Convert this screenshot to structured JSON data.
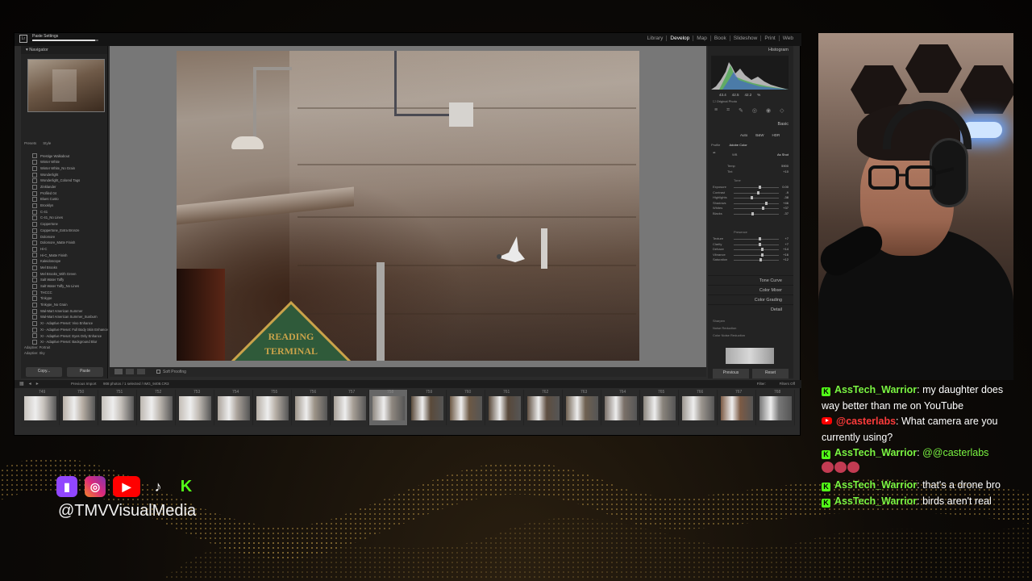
{
  "lightroom": {
    "identity_text": "Paste Settings",
    "progress": 0.95,
    "modules": [
      {
        "label": "Library",
        "active": false
      },
      {
        "label": "Develop",
        "active": true
      },
      {
        "label": "Map",
        "active": false
      },
      {
        "label": "Book",
        "active": false
      },
      {
        "label": "Slideshow",
        "active": false
      },
      {
        "label": "Print",
        "active": false
      },
      {
        "label": "Web",
        "active": false
      }
    ],
    "left_panel": {
      "navigator_label": "Navigator",
      "presets_tabs": [
        "Presets",
        "Style"
      ],
      "items": [
        "Prestige Walkabout",
        "Winter White",
        "Winter White_No Grain",
        "Wonderlight",
        "Wonderlight_Colored Tags",
        "Zinklander",
        "Profiled 04",
        "Blues Custo",
        "Brooklyn",
        "C-41",
        "C-41_No Lines",
        "Coppertone",
        "Coppertone_Extra Bronze",
        "Dolomore",
        "Dolomore_Matte Finish",
        "Hi-C",
        "Hi-C_Matte Finish",
        "Kaleidoscope",
        "Mel Brooks",
        "Mel Brooks_With Green",
        "Salt Water Taffy",
        "Salt Water Taffy_No Lines",
        "THCCC",
        "Tinkype",
        "Tinkype_No Grain",
        "Wal-Mart American Summer",
        "Wal-Mart American Summer_Sunburn",
        "XI - Adaptive Preset: Vivo Enhance",
        "XI - Adaptive Preset: Full Body Skin Enhance",
        "XI - Adaptive Preset: Eyes Only Enhance",
        "XI - Adaptive Preset: Background Blur"
      ],
      "groups": [
        "Adaptive: Portrait",
        "Adaptive: Sky"
      ],
      "copy_button": "Copy...",
      "paste_button": "Paste"
    },
    "center": {
      "toolbar_label": "Soft Proofing"
    },
    "right_panel": {
      "histogram_label": "Histogram",
      "histogram_values": [
        "43.4",
        "42.5",
        "42.2",
        "%"
      ],
      "original_photo": "Original Photo",
      "basic_label": "Basic",
      "treatment_options": [
        "Auto",
        "B&W",
        "HDR"
      ],
      "profile_label": "Profile",
      "profile_value": "Adobe Color",
      "wb_label": "WB",
      "wb_value": "As Shot",
      "temp_label": "Temp",
      "temp_value": "5900",
      "tint_label": "Tint",
      "tint_value": "+10",
      "tone_label": "Tone",
      "sliders": [
        {
          "label": "Exposure",
          "value": "0.00",
          "pos": 0.55
        },
        {
          "label": "Contrast",
          "value": "-9",
          "pos": 0.52
        },
        {
          "label": "Highlights",
          "value": "-38",
          "pos": 0.38
        },
        {
          "label": "Shadows",
          "value": "+46",
          "pos": 0.7
        },
        {
          "label": "Whites",
          "value": "+37",
          "pos": 0.62
        },
        {
          "label": "Blacks",
          "value": "-37",
          "pos": 0.4
        }
      ],
      "presence_label": "Presence",
      "presence_sliders": [
        {
          "label": "Texture",
          "value": "+7",
          "pos": 0.56
        },
        {
          "label": "Clarity",
          "value": "+7",
          "pos": 0.56
        },
        {
          "label": "Dehaze",
          "value": "+14",
          "pos": 0.6
        },
        {
          "label": "Vibrance",
          "value": "+16",
          "pos": 0.6
        },
        {
          "label": "Saturation",
          "value": "+12",
          "pos": 0.58
        }
      ],
      "sections": [
        "Tone Curve",
        "Color Mixer",
        "Color Grading",
        "Detail"
      ],
      "detail_rows": [
        "Sharpen",
        "Noise Reduction",
        "Color Noise Reduction"
      ],
      "previous_button": "Previous",
      "reset_button": "Reset"
    },
    "filmstrip": {
      "source": "Previous Import",
      "info": "908 photos / 1 selected / IMG_9408.CR3",
      "filter_label": "Filter:",
      "filter_value": "Filters Off",
      "frame_numbers": [
        "749",
        "750",
        "751",
        "752",
        "753",
        "754",
        "755",
        "756",
        "757",
        "758",
        "759",
        "760",
        "761",
        "762",
        "763",
        "764",
        "765",
        "766",
        "767",
        "768"
      ],
      "selected_index": 9
    }
  },
  "socials": {
    "handle": "@TMVVisualMedia",
    "icons": [
      "twitch-icon",
      "instagram-icon",
      "youtube-icon",
      "tiktok-icon",
      "kick-icon"
    ]
  },
  "chat": [
    {
      "platform": "kick",
      "user": "AssTech_Warrior",
      "text": "my daughter does way better than me on YouTube"
    },
    {
      "platform": "youtube",
      "user": "@casterlabs",
      "text": "What camera are you currently using?"
    },
    {
      "platform": "kick",
      "user": "AssTech_Warrior",
      "text": "@@casterlabs",
      "emotes": 3
    },
    {
      "platform": "kick",
      "user": "AssTech_Warrior",
      "text": "that's a drone bro"
    },
    {
      "platform": "kick",
      "user": "AssTech_Warrior",
      "text": "birds aren't real"
    }
  ],
  "colors": {
    "kick": "#53fc18",
    "youtube": "#ff0000",
    "twitch": "#9146ff"
  }
}
